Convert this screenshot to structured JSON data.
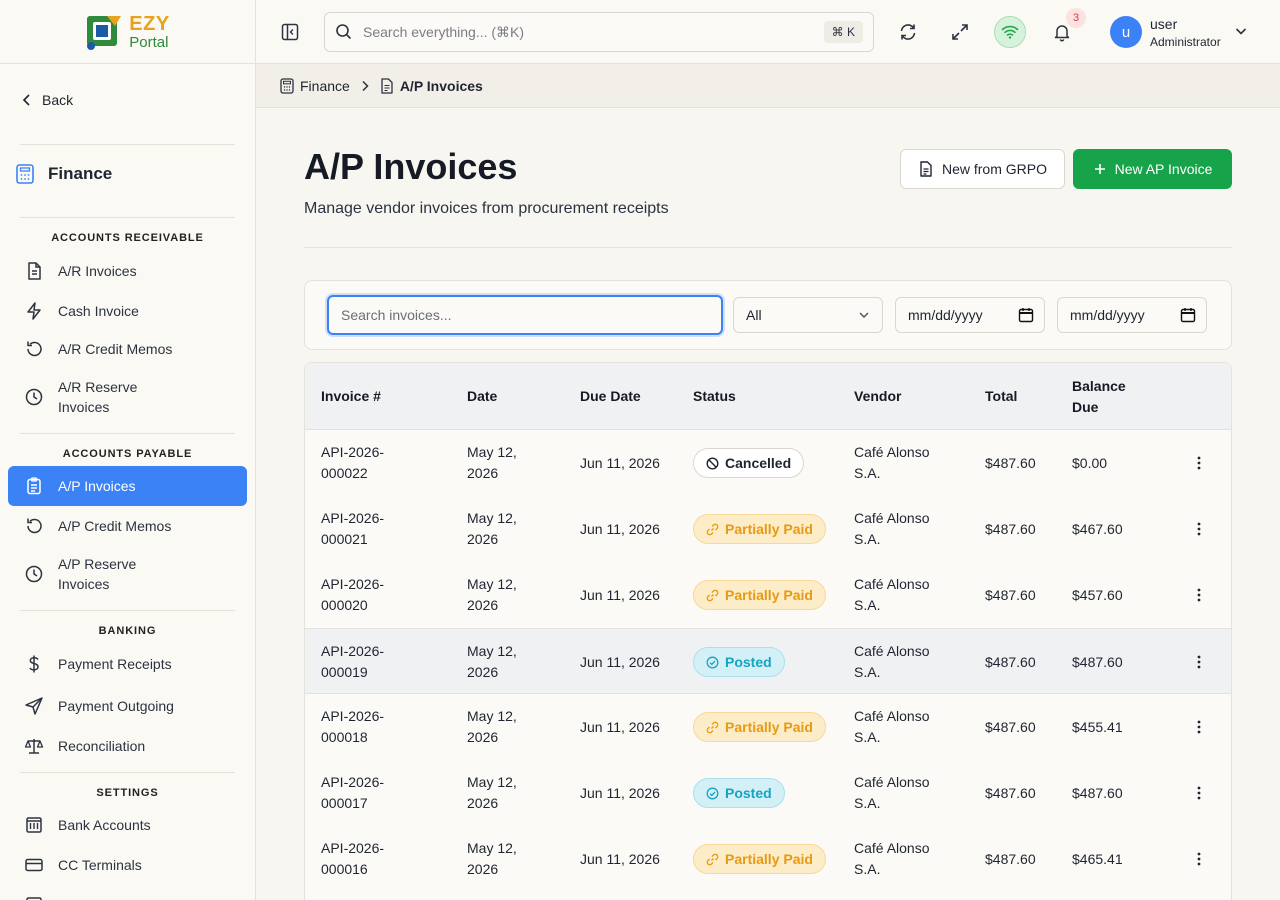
{
  "brand": {
    "name_top": "EZY",
    "name_bottom": "Portal"
  },
  "sidebar": {
    "back_label": "Back",
    "module_title": "Finance",
    "groups": {
      "receivable": "ACCOUNTS RECEIVABLE",
      "payable": "ACCOUNTS PAYABLE",
      "banking": "BANKING",
      "settings": "SETTINGS"
    },
    "items": {
      "ar_invoices": "A/R Invoices",
      "cash_invoice": "Cash Invoice",
      "ar_credit_memos": "A/R Credit Memos",
      "ar_reserve_1": "A/R Reserve",
      "ar_reserve_2": "Invoices",
      "ap_invoices": "A/P Invoices",
      "ap_credit_memos": "A/P Credit Memos",
      "ap_reserve_1": "A/P Reserve",
      "ap_reserve_2": "Invoices",
      "payment_receipts": "Payment Receipts",
      "payment_outgoing": "Payment Outgoing",
      "reconciliation": "Reconciliation",
      "bank_accounts": "Bank Accounts",
      "cc_terminals": "CC Terminals"
    }
  },
  "topbar": {
    "search_placeholder": "Search everything... (⌘K)",
    "shortcut": "⌘ K",
    "notification_count": "3",
    "user_initial": "u",
    "user_name": "user",
    "user_role": "Administrator"
  },
  "breadcrumb": {
    "parent": "Finance",
    "current": "A/P Invoices"
  },
  "page": {
    "title": "A/P Invoices",
    "subtitle": "Manage vendor invoices from procurement receipts",
    "btn_secondary": "New from GRPO",
    "btn_primary": "New AP Invoice"
  },
  "filters": {
    "search_placeholder": "Search invoices...",
    "status_value": "All",
    "date_from": "mm/dd/yyyy",
    "date_to": "mm/dd/yyyy"
  },
  "table": {
    "columns": {
      "invoice": "Invoice #",
      "date": "Date",
      "due": "Due Date",
      "status": "Status",
      "vendor": "Vendor",
      "total": "Total",
      "balance_1": "Balance",
      "balance_2": "Due"
    },
    "rows": [
      {
        "inv1": "API-2026-",
        "inv2": "000022",
        "d1": "May 12,",
        "d2": "2026",
        "due": "Jun 11, 2026",
        "status": "Cancelled",
        "v1": "Café Alonso",
        "v2": "S.A.",
        "total": "$487.60",
        "balance": "$0.00"
      },
      {
        "inv1": "API-2026-",
        "inv2": "000021",
        "d1": "May 12,",
        "d2": "2026",
        "due": "Jun 11, 2026",
        "status": "Partially Paid",
        "v1": "Café Alonso",
        "v2": "S.A.",
        "total": "$487.60",
        "balance": "$467.60"
      },
      {
        "inv1": "API-2026-",
        "inv2": "000020",
        "d1": "May 12,",
        "d2": "2026",
        "due": "Jun 11, 2026",
        "status": "Partially Paid",
        "v1": "Café Alonso",
        "v2": "S.A.",
        "total": "$487.60",
        "balance": "$457.60"
      },
      {
        "inv1": "API-2026-",
        "inv2": "000019",
        "d1": "May 12,",
        "d2": "2026",
        "due": "Jun 11, 2026",
        "status": "Posted",
        "v1": "Café Alonso",
        "v2": "S.A.",
        "total": "$487.60",
        "balance": "$487.60"
      },
      {
        "inv1": "API-2026-",
        "inv2": "000018",
        "d1": "May 12,",
        "d2": "2026",
        "due": "Jun 11, 2026",
        "status": "Partially Paid",
        "v1": "Café Alonso",
        "v2": "S.A.",
        "total": "$487.60",
        "balance": "$455.41"
      },
      {
        "inv1": "API-2026-",
        "inv2": "000017",
        "d1": "May 12,",
        "d2": "2026",
        "due": "Jun 11, 2026",
        "status": "Posted",
        "v1": "Café Alonso",
        "v2": "S.A.",
        "total": "$487.60",
        "balance": "$487.60"
      },
      {
        "inv1": "API-2026-",
        "inv2": "000016",
        "d1": "May 12,",
        "d2": "2026",
        "due": "Jun 11, 2026",
        "status": "Partially Paid",
        "v1": "Café Alonso",
        "v2": "S.A.",
        "total": "$487.60",
        "balance": "$465.41"
      }
    ]
  },
  "colors": {
    "accent": "#3b82f6",
    "primary_button": "#16a34a",
    "status_partial": "#e79a13",
    "status_posted": "#16a3c4",
    "notification": "#dc3b3b"
  },
  "icons": {
    "sidebar_toggle": "panel-left-icon",
    "refresh": "refresh-icon",
    "fullscreen": "expand-icon",
    "connection": "wifi-icon",
    "notifications": "bell-icon",
    "row_actions": "more-vertical-icon"
  }
}
